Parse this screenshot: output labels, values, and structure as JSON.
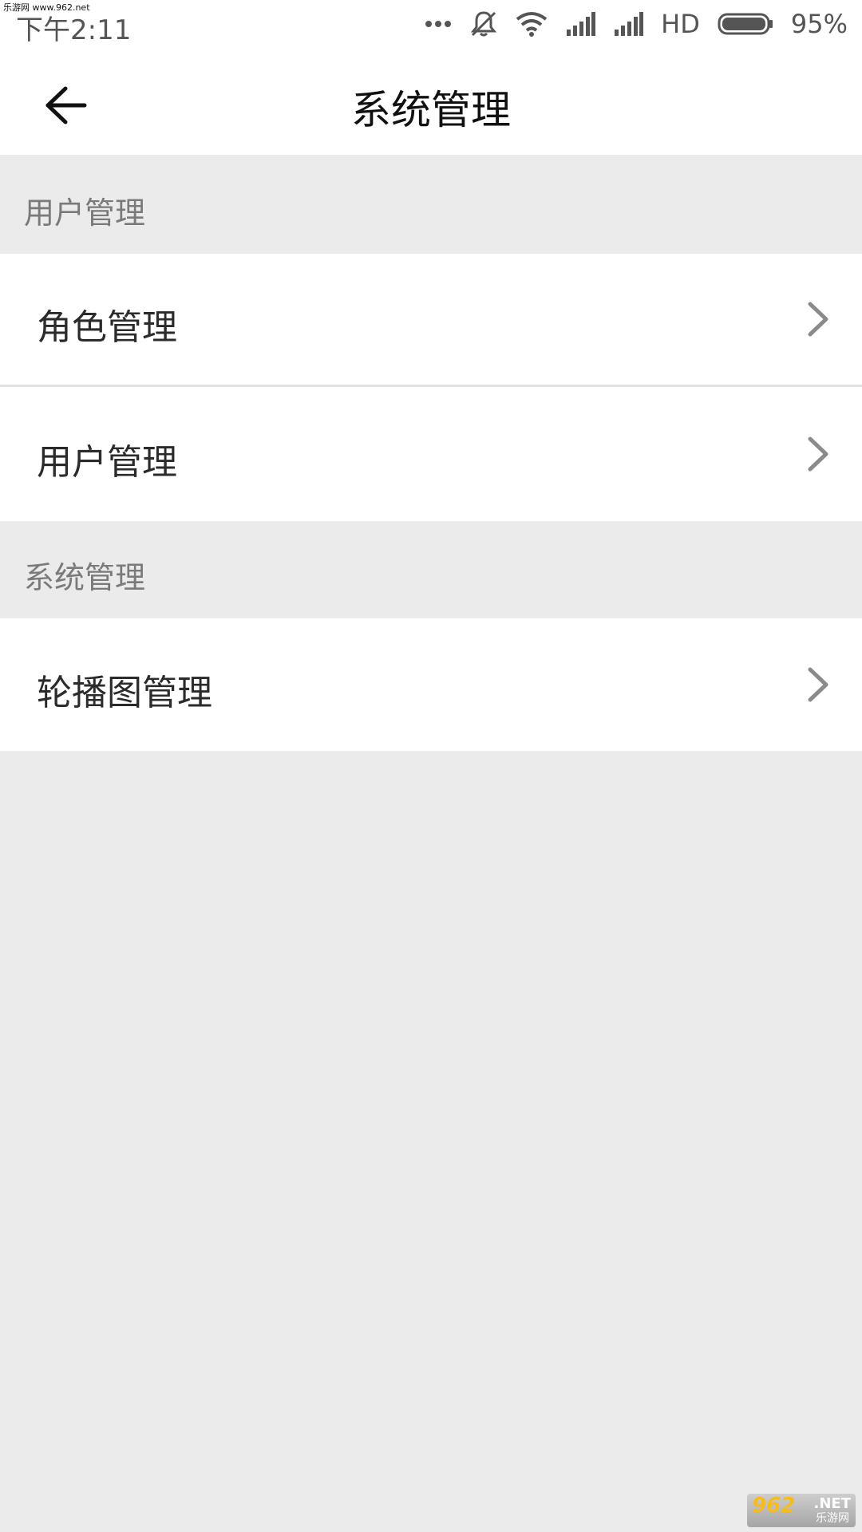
{
  "watermark": {
    "site_text": "乐游网 www.962.net",
    "logo_main": "962",
    "logo_net": ".NET",
    "logo_sub": "乐游网"
  },
  "status_bar": {
    "time": "下午2:11",
    "network_type": "HD",
    "battery_percent": "95%",
    "icons": [
      "more-dots-icon",
      "mute-notification-icon",
      "wifi-icon",
      "signal-icon",
      "signal-icon",
      "battery-icon"
    ]
  },
  "app_bar": {
    "back_icon": "arrow-left-icon",
    "title": "系统管理"
  },
  "sections": [
    {
      "header": "用户管理",
      "items": [
        {
          "label": "角色管理",
          "icon": "chevron-right-icon"
        },
        {
          "label": "用户管理",
          "icon": "chevron-right-icon"
        }
      ]
    },
    {
      "header": "系统管理",
      "items": [
        {
          "label": "轮播图管理",
          "icon": "chevron-right-icon"
        }
      ]
    }
  ],
  "colors": {
    "page_background": "#ebebeb",
    "surface": "#ffffff",
    "section_header_text": "#7a7a7a",
    "item_text": "#2b2b2b",
    "chevron": "#8a8a8a"
  }
}
